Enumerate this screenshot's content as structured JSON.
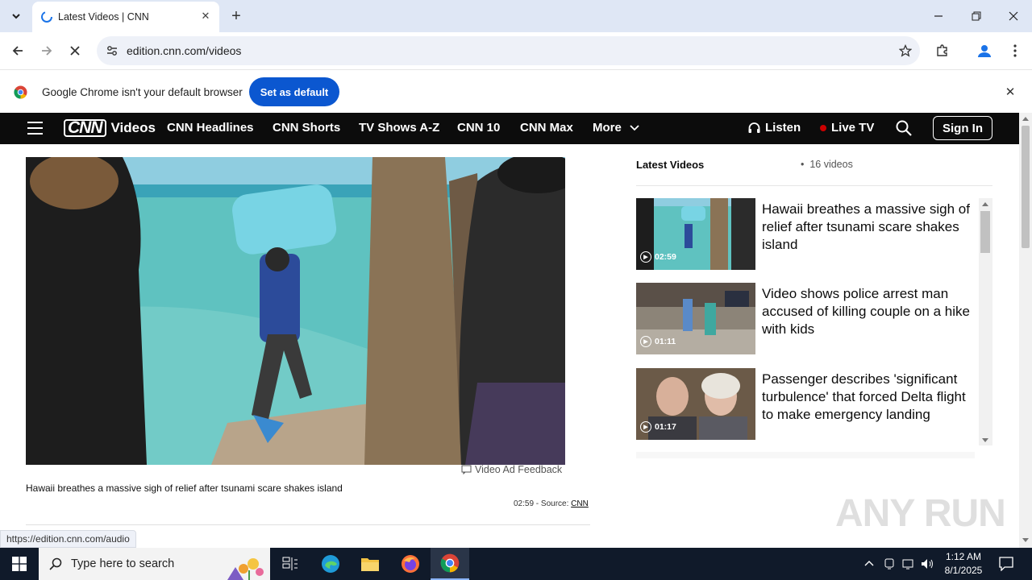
{
  "browser": {
    "tab_title": "Latest Videos | CNN",
    "url": "edition.cnn.com/videos",
    "infobar_text": "Google Chrome isn't your default browser",
    "set_default_label": "Set as default",
    "status_url": "https://edition.cnn.com/audio"
  },
  "cnn_nav": {
    "logo": "CNN",
    "section": "Videos",
    "items": [
      "CNN Headlines",
      "CNN Shorts",
      "TV Shows A-Z",
      "CNN 10",
      "CNN Max",
      "More"
    ],
    "listen": "Listen",
    "live_tv": "Live TV",
    "sign_in": "Sign In"
  },
  "main": {
    "ad_feedback": "Video Ad Feedback",
    "caption": "Hawaii breathes a massive sigh of relief after tsunami scare shakes island",
    "meta_prefix": "02:59 - Source: ",
    "source": "CNN"
  },
  "sidebar": {
    "title": "Latest Videos",
    "count": "16 videos",
    "videos": [
      {
        "title": "Hawaii breathes a massive sigh of relief after tsunami scare shakes island",
        "duration": "02:59"
      },
      {
        "title": "Video shows police arrest man accused of killing couple on a hike with kids",
        "duration": "01:11"
      },
      {
        "title": "Passenger describes 'significant turbulence' that forced Delta flight to make emergency landing",
        "duration": "01:17"
      }
    ]
  },
  "watermark": "ANY RUN",
  "taskbar": {
    "search_placeholder": "Type here to search",
    "time": "1:12 AM",
    "date": "8/1/2025"
  },
  "colors": {
    "cnn_bar": "#0c0c0c",
    "live_dot": "#cc0000",
    "chrome_button": "#0b57d0",
    "tab_strip": "#dfe7f5"
  }
}
